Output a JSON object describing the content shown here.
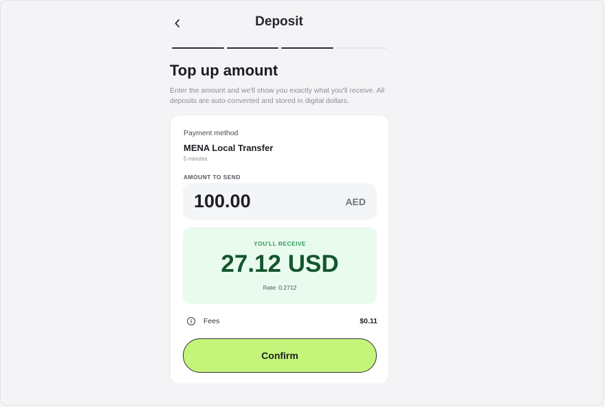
{
  "header": {
    "title": "Deposit",
    "back_icon": "chevron-left-icon"
  },
  "progress": {
    "steps_total": 4,
    "steps_completed": 3
  },
  "main": {
    "heading": "Top up amount",
    "description": "Enter the amount and we'll show you exactly what you'll receive. All deposits are auto-converted and stored in digital dollars."
  },
  "card": {
    "payment_method_label": "Payment method",
    "payment_method_name": "MENA Local Transfer",
    "payment_method_time": "5 minutes",
    "amount_label": "AMOUNT TO SEND",
    "amount_value": "100.00",
    "amount_currency": "AED",
    "receive_label": "YOU'LL RECEIVE",
    "receive_amount": "27.12 USD",
    "rate": "Rate: 0.2712",
    "fees_icon": "info-icon",
    "fees_label": "Fees",
    "fees_value": "$0.11",
    "confirm_label": "Confirm"
  },
  "colors": {
    "accent": "#c4f57a",
    "receive_bg": "#e9fbee",
    "receive_text": "#14562f",
    "receive_label": "#2f9a5a"
  }
}
